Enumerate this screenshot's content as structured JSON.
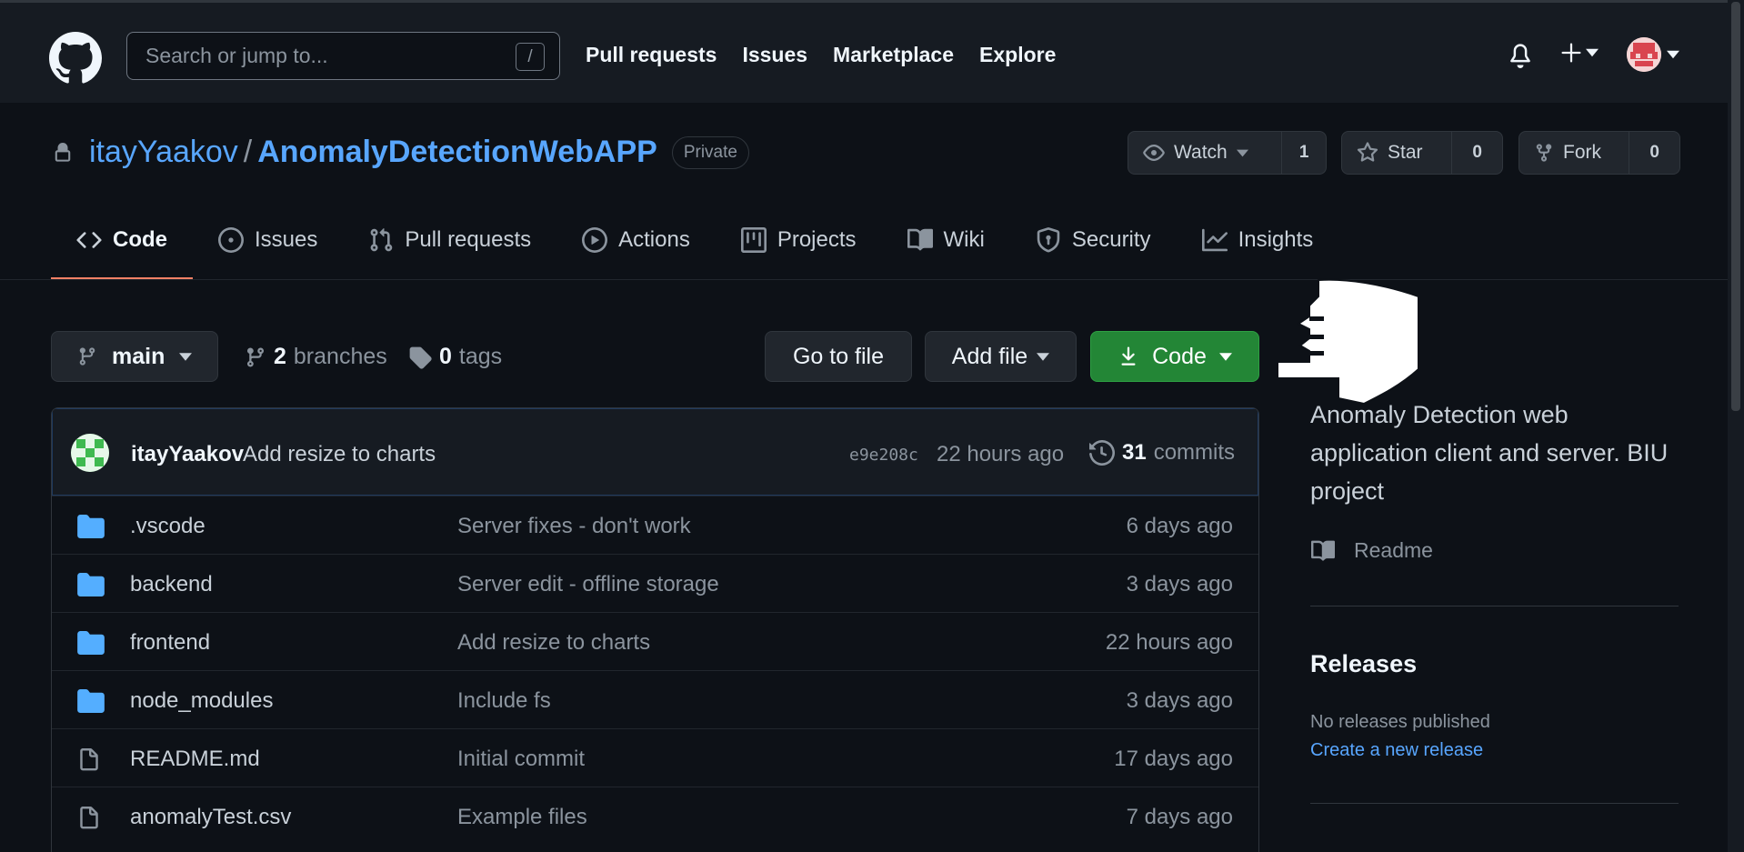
{
  "header": {
    "search_placeholder": "Search or jump to...",
    "search_shortcut": "/",
    "nav": [
      "Pull requests",
      "Issues",
      "Marketplace",
      "Explore"
    ]
  },
  "repo": {
    "owner": "itayYaakov",
    "separator": "/",
    "name": "AnomalyDetectionWebAPP",
    "visibility": "Private",
    "watch_label": "Watch",
    "watch_count": "1",
    "star_label": "Star",
    "star_count": "0",
    "fork_label": "Fork",
    "fork_count": "0"
  },
  "tabs": [
    "Code",
    "Issues",
    "Pull requests",
    "Actions",
    "Projects",
    "Wiki",
    "Security",
    "Insights"
  ],
  "branch_bar": {
    "branch": "main",
    "branches_count": "2",
    "branches_label": "branches",
    "tags_count": "0",
    "tags_label": "tags",
    "go_to_file": "Go to file",
    "add_file": "Add file",
    "code": "Code"
  },
  "latest_commit": {
    "author": "itayYaakov",
    "message": "Add resize to charts",
    "sha": "e9e208c",
    "time": "22 hours ago",
    "commits_count": "31",
    "commits_label": "commits"
  },
  "files": [
    {
      "type": "dir",
      "name": ".vscode",
      "message": "Server fixes - don't work",
      "time": "6 days ago"
    },
    {
      "type": "dir",
      "name": "backend",
      "message": "Server edit - offline storage",
      "time": "3 days ago"
    },
    {
      "type": "dir",
      "name": "frontend",
      "message": "Add resize to charts",
      "time": "22 hours ago"
    },
    {
      "type": "dir",
      "name": "node_modules",
      "message": "Include fs",
      "time": "3 days ago"
    },
    {
      "type": "file",
      "name": "README.md",
      "message": "Initial commit",
      "time": "17 days ago"
    },
    {
      "type": "file",
      "name": "anomalyTest.csv",
      "message": "Example files",
      "time": "7 days ago"
    }
  ],
  "sidebar": {
    "about": "Anomaly Detection web application client and server. BIU project",
    "readme": "Readme",
    "releases_title": "Releases",
    "no_releases": "No releases published",
    "create_release": "Create a new release"
  },
  "colors": {
    "bg": "#0d1117",
    "header_bg": "#161b22",
    "link": "#58a6ff",
    "green_button": "#238636",
    "active_tab_underline": "#f78166",
    "folder": "#54aeff"
  }
}
